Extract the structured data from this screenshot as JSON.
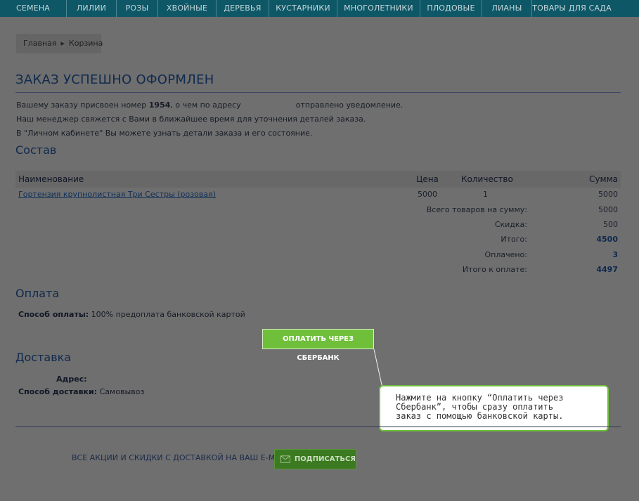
{
  "nav": [
    "Семена",
    "Лилии",
    "Розы",
    "Хвойные",
    "Деревья",
    "Кустарники",
    "Многолетники",
    "Плодовые",
    "Лианы",
    "Товары для сада"
  ],
  "breadcrumb": {
    "home": "Главная",
    "current": "Корзина"
  },
  "title": "ЗАКАЗ УСПЕШНО ОФОРМЛЕН",
  "message": {
    "line1_a": "Вашему заказу присвоен номер ",
    "order_number": "1954",
    "line1_b": ", о чем по адресу",
    "line1_c": "отправлено уведомление.",
    "line2": "Наш менеджер свяжется с Вами в ближайшее время для уточнения деталей заказа.",
    "line3": "В \"Личном кабинете\" Вы можете узнать детали заказа и его состояние."
  },
  "composition": {
    "heading": "Состав",
    "columns": {
      "name": "Наименование",
      "price": "Цена",
      "qty": "Количество",
      "sum": "Сумма"
    },
    "item": {
      "name": "Гортензия крупнолистная Три Сестры (розовая)",
      "price": "5000",
      "qty": "1",
      "sum": "5000"
    },
    "totals": [
      {
        "label": "Всего товаров на сумму:",
        "value": "5000",
        "bold": false
      },
      {
        "label": "Скидка:",
        "value": "500",
        "bold": false
      },
      {
        "label": "Итого:",
        "value": "4500",
        "bold": true
      },
      {
        "label": "Оплачено:",
        "value": "3",
        "bold": true
      },
      {
        "label": "Итого к оплате:",
        "value": "4497",
        "bold": true
      }
    ]
  },
  "payment": {
    "heading": "Оплата",
    "method_label": "Способ оплаты:",
    "method_value": "100% предоплата банковской картой",
    "pay_button": "ОПЛАТИТЬ ЧЕРЕЗ СБЕРБАНК"
  },
  "delivery": {
    "heading": "Доставка",
    "address_label": "Адрес:",
    "method_label": "Способ доставки:",
    "method_value": "Самовывоз"
  },
  "callout": {
    "line1": "Нажмите на кнопку “Оплатить через",
    "line2": "Сбербанк”, чтобы сразу оплатить",
    "line3": "заказ с помощью банковской карты."
  },
  "footer": {
    "promo": "ВСЕ АКЦИИ И СКИДКИ С ДОСТАВКОЙ НА ВАШ E-MAIL",
    "subscribe": "ПОДПИСАТЬСЯ"
  },
  "colors": {
    "nav_bg": "#0e5766",
    "accent_green": "#6fbf3b",
    "overlay_bg": "#6f6f6f"
  }
}
